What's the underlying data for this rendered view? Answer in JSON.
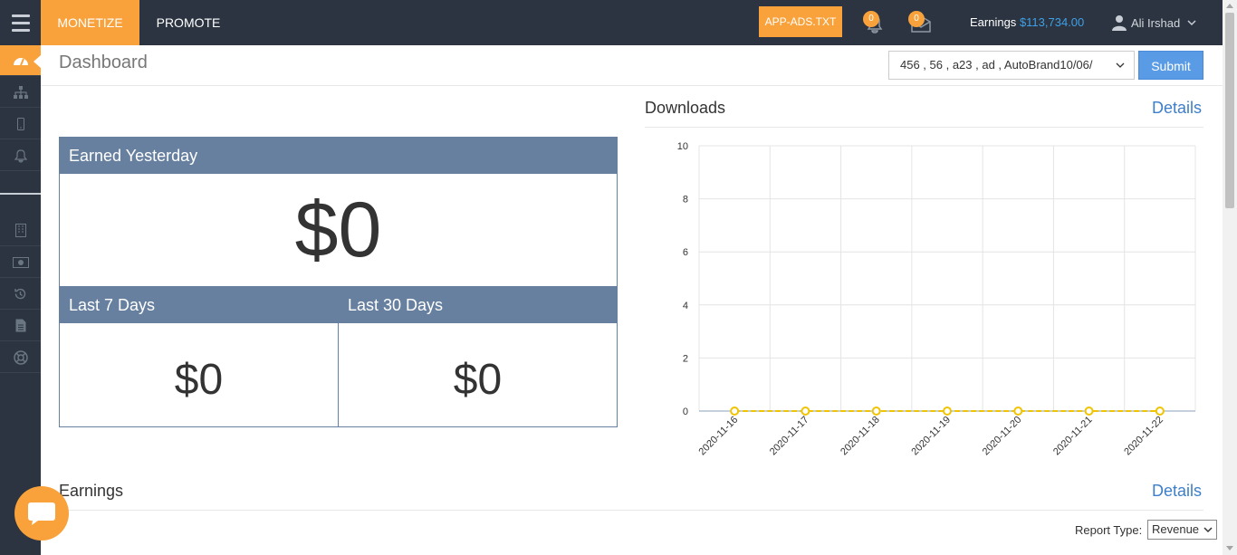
{
  "nav": {
    "monetize": "MONETIZE",
    "promote": "PROMOTE",
    "app_ads": "APP-ADS.TXT",
    "notifications_count": "0",
    "messages_count": "0",
    "earnings_label": "Earnings",
    "earnings_amount": "$113,734.00",
    "user_name": "Ali Irshad"
  },
  "sidebar": {
    "items": [
      {
        "icon": "dashboard-icon"
      },
      {
        "icon": "sitemap-icon"
      },
      {
        "icon": "mobile-icon"
      },
      {
        "icon": "bell-icon"
      },
      {
        "icon": "building-icon"
      },
      {
        "icon": "money-icon"
      },
      {
        "icon": "history-icon"
      },
      {
        "icon": "document-icon"
      },
      {
        "icon": "support-icon"
      }
    ]
  },
  "header": {
    "title": "Dashboard",
    "app_select_value": "456 , 56 , a23 , ad , AutoBrand10/06/",
    "submit": "Submit"
  },
  "stats": {
    "yesterday_label": "Earned Yesterday",
    "yesterday_value": "$0",
    "last7_label": "Last 7 Days",
    "last7_value": "$0",
    "last30_label": "Last 30 Days",
    "last30_value": "$0"
  },
  "downloads": {
    "title": "Downloads",
    "details": "Details"
  },
  "chart_data": {
    "type": "line",
    "x": [
      "2020-11-16",
      "2020-11-17",
      "2020-11-18",
      "2020-11-19",
      "2020-11-20",
      "2020-11-21",
      "2020-11-22"
    ],
    "series": [
      {
        "values": [
          0,
          0,
          0,
          0,
          0,
          0,
          0
        ],
        "color": "#f0c400"
      }
    ],
    "yticks": [
      "0",
      "2",
      "4",
      "6",
      "8",
      "10"
    ],
    "ylim": [
      0,
      10
    ],
    "grid": true
  },
  "earnings": {
    "title": "Earnings",
    "details": "Details",
    "report_type_label": "Report Type:",
    "report_type_value": "Revenue"
  },
  "colors": {
    "accent": "#f9a23c",
    "panel_header": "#67809f",
    "link": "#3d7fc9",
    "topbar": "#2b3440"
  }
}
